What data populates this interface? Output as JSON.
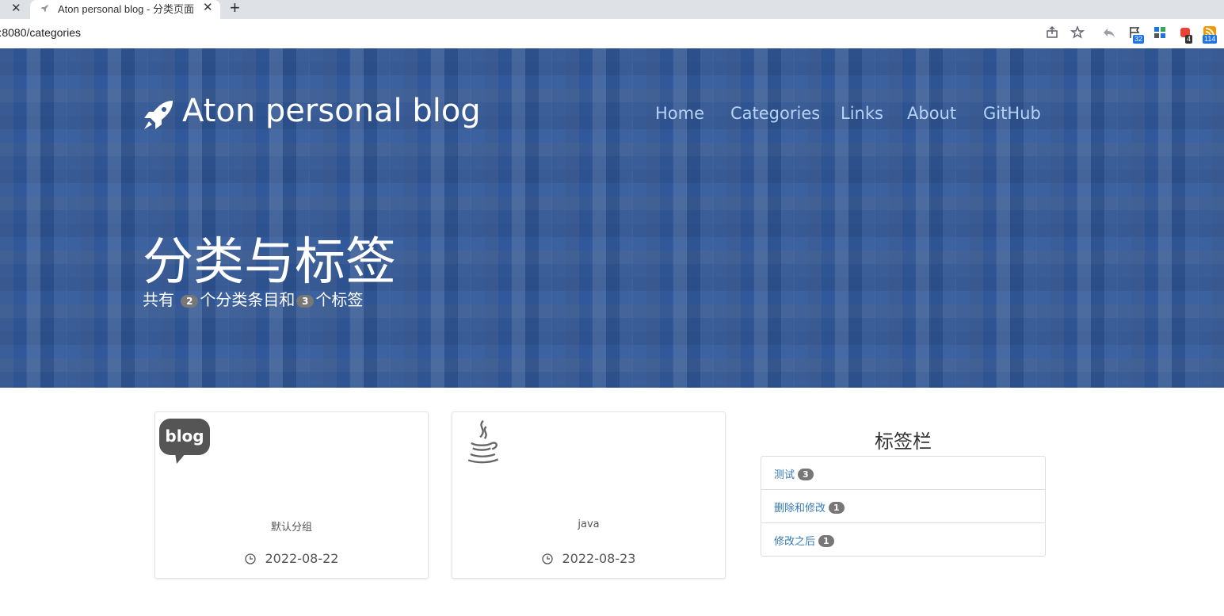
{
  "browser": {
    "tab_title": "Aton personal blog - 分类页面",
    "url_host": "host",
    "url_rest": ":8080/categories",
    "new_tab_glyph": "+",
    "close_glyph": "✕",
    "extension_badges": [
      "32",
      "4",
      "114"
    ]
  },
  "header": {
    "brand": "Aton personal blog",
    "nav": [
      "Home",
      "Categories",
      "Links",
      "About",
      "GitHub"
    ]
  },
  "hero": {
    "title": "分类与标签",
    "subtitle_prefix": "共有",
    "category_count": "2",
    "subtitle_mid": "个分类条目和",
    "tag_count": "3",
    "subtitle_suffix": "个标签"
  },
  "categories": [
    {
      "name": "默认分组",
      "date": "2022-08-22",
      "icon": "blog-icon"
    },
    {
      "name": "java",
      "date": "2022-08-23",
      "icon": "java-icon"
    }
  ],
  "tags_panel": {
    "title": "标签栏",
    "items": [
      {
        "label": "测试",
        "count": "3"
      },
      {
        "label": "删除和修改",
        "count": "1"
      },
      {
        "label": "修改之后",
        "count": "1"
      }
    ]
  },
  "colors": {
    "hero_bg": "#31589a",
    "nav_text": "#b7d2f5",
    "link": "#337ab7",
    "badge": "#777777"
  }
}
